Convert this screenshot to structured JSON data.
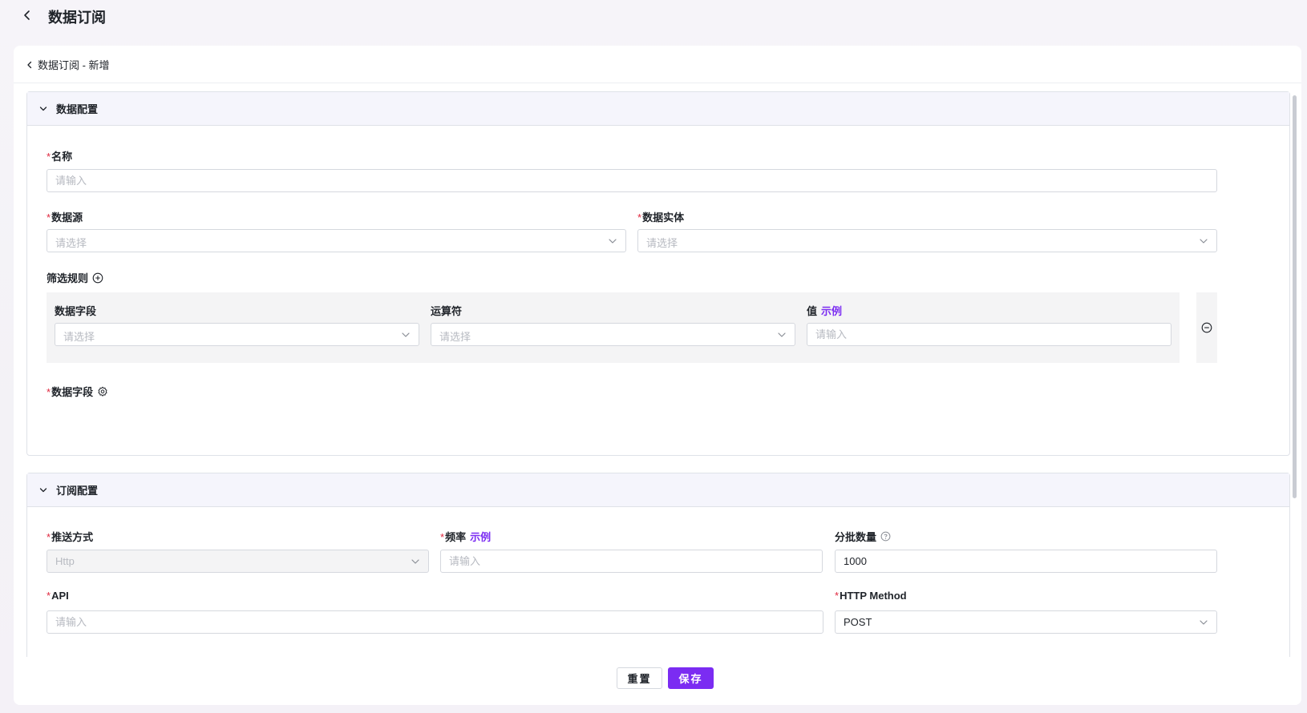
{
  "header": {
    "title": "数据订阅"
  },
  "breadcrumb": {
    "label": "数据订阅 - 新增"
  },
  "data_config": {
    "title": "数据配置",
    "name_label": "名称",
    "name_placeholder": "请输入",
    "datasource_label": "数据源",
    "datasource_placeholder": "请选择",
    "entity_label": "数据实体",
    "entity_placeholder": "请选择",
    "filter_label": "筛选规则",
    "filter": {
      "field_label": "数据字段",
      "field_placeholder": "请选择",
      "operator_label": "运算符",
      "operator_placeholder": "请选择",
      "value_label": "值",
      "value_example": "示例",
      "value_placeholder": "请输入"
    },
    "fields_label": "数据字段"
  },
  "subscribe_config": {
    "title": "订阅配置",
    "push_label": "推送方式",
    "push_value": "Http",
    "freq_label": "频率",
    "freq_example": "示例",
    "freq_placeholder": "请输入",
    "batch_label": "分批数量",
    "batch_value": "1000",
    "api_label": "API",
    "api_placeholder": "请输入",
    "method_label": "HTTP Method",
    "method_value": "POST"
  },
  "footer": {
    "reset_label": "重置",
    "save_label": "保存"
  },
  "colors": {
    "accent": "#7b2cf2",
    "required": "#e0283f",
    "section_header": "#f5f5fc"
  }
}
